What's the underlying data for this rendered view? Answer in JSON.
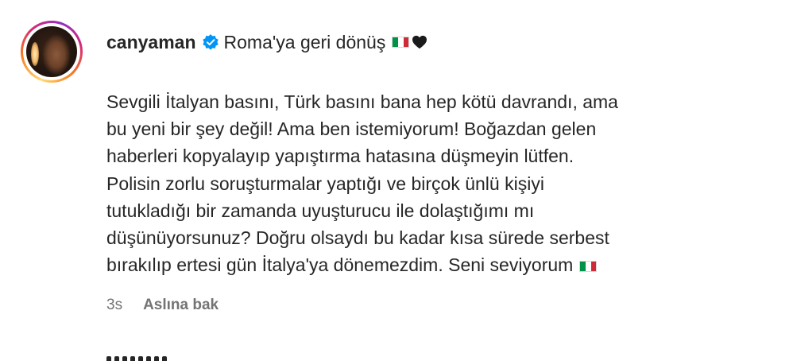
{
  "post": {
    "username": "canyaman",
    "title": "Roma'ya geri dönüş",
    "body_lines": [
      "Sevgili İtalyan basını, Türk basını bana hep kötü davrandı, ama",
      "bu yeni bir şey değil! Ama ben istemiyorum! Boğazdan gelen",
      "haberleri kopyalayıp yapıştırma hatasına düşmeyin lütfen.",
      "Polisin zorlu soruşturmalar yaptığı ve birçok ünlü kişiyi",
      "tutukladığı bir zamanda uyuşturucu ile dolaştığımı mı",
      "düşünüyorsunuz? Doğru olsaydı bu kadar kısa sürede serbest",
      "bırakılıp ertesi gün İtalya'ya dönemezdim. Seni seviyorum"
    ],
    "time": "3s",
    "translate_label": "Aslına bak"
  },
  "icons": {
    "verified": "verified-badge-icon",
    "flag": "italy-flag-icon",
    "heart": "black-heart-icon"
  },
  "colors": {
    "verified_blue": "#0095f6",
    "flag_green": "#009246",
    "flag_white": "#ffffff",
    "flag_red": "#ce2b37",
    "text": "#262626",
    "muted": "#737373"
  }
}
